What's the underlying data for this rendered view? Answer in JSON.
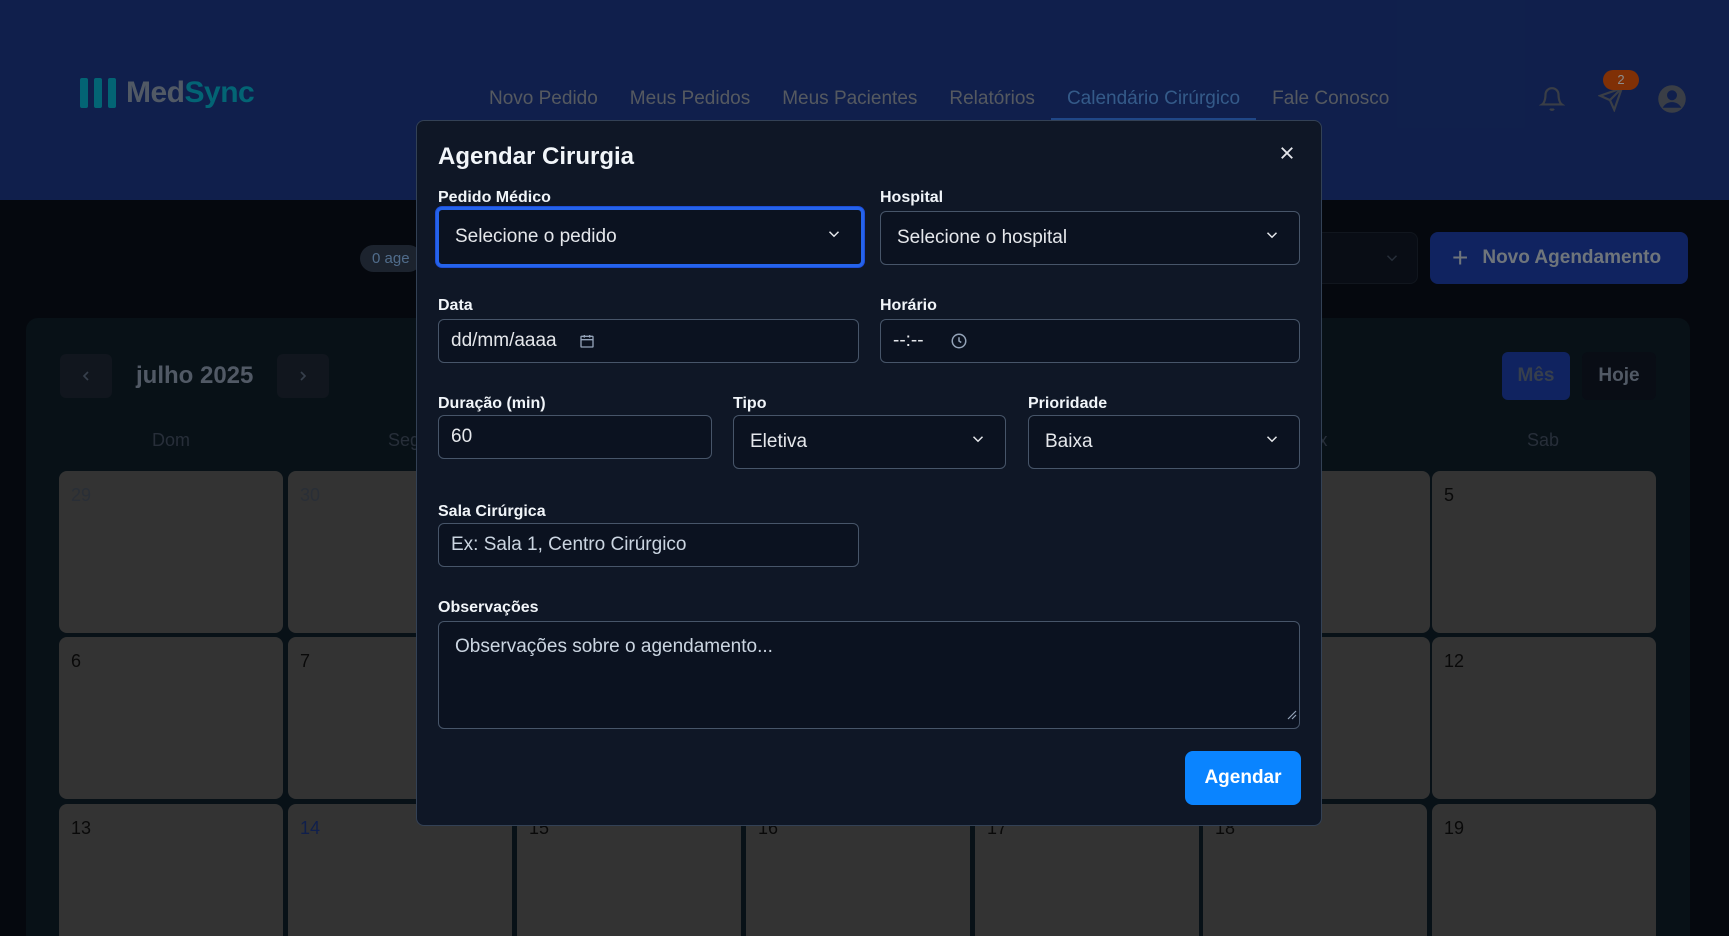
{
  "app": {
    "logo_prefix": "Med",
    "logo_suffix": "Sync"
  },
  "nav": {
    "items": [
      {
        "label": "Novo Pedido"
      },
      {
        "label": "Meus Pedidos"
      },
      {
        "label": "Meus Pacientes"
      },
      {
        "label": "Relatórios"
      },
      {
        "label": "Calendário Cirúrgico",
        "active": true
      },
      {
        "label": "Fale Conosco"
      }
    ],
    "messages_badge": "2"
  },
  "toolbar": {
    "count_pill": "0 age",
    "new_button_label": "Novo Agendamento"
  },
  "calendar": {
    "month_label": "julho 2025",
    "view_month_label": "Mês",
    "today_label": "Hoje",
    "weekdays_visible": {
      "dom": "Dom",
      "seg": "Seg",
      "sex": "x",
      "sab": "Sab"
    },
    "days": {
      "d29": "29",
      "d30": "30",
      "d5": "5",
      "d6": "6",
      "d7": "7",
      "d12": "12",
      "d13": "13",
      "d14": "14",
      "d15": "15",
      "d16": "16",
      "d17": "17",
      "d18": "18",
      "d19": "19"
    }
  },
  "modal": {
    "title": "Agendar Cirurgia",
    "pedido": {
      "label": "Pedido Médico",
      "value": "Selecione o pedido"
    },
    "hospital": {
      "label": "Hospital",
      "value": "Selecione o hospital"
    },
    "data": {
      "label": "Data",
      "value": "dd/mm/aaaa"
    },
    "horario": {
      "label": "Horário",
      "value": "--:--"
    },
    "duracao": {
      "label": "Duração (min)",
      "value": "60"
    },
    "tipo": {
      "label": "Tipo",
      "value": "Eletiva"
    },
    "prioridade": {
      "label": "Prioridade",
      "value": "Baixa"
    },
    "sala": {
      "label": "Sala Cirúrgica",
      "placeholder": "Ex: Sala 1, Centro Cirúrgico"
    },
    "observacoes": {
      "label": "Observações",
      "placeholder": "Observações sobre o agendamento..."
    },
    "submit_label": "Agendar"
  },
  "colors": {
    "header_bg": "#1e3a8a",
    "accent": "#0a84ff",
    "modal_bg": "#0f1726",
    "badge": "#ea580c"
  }
}
